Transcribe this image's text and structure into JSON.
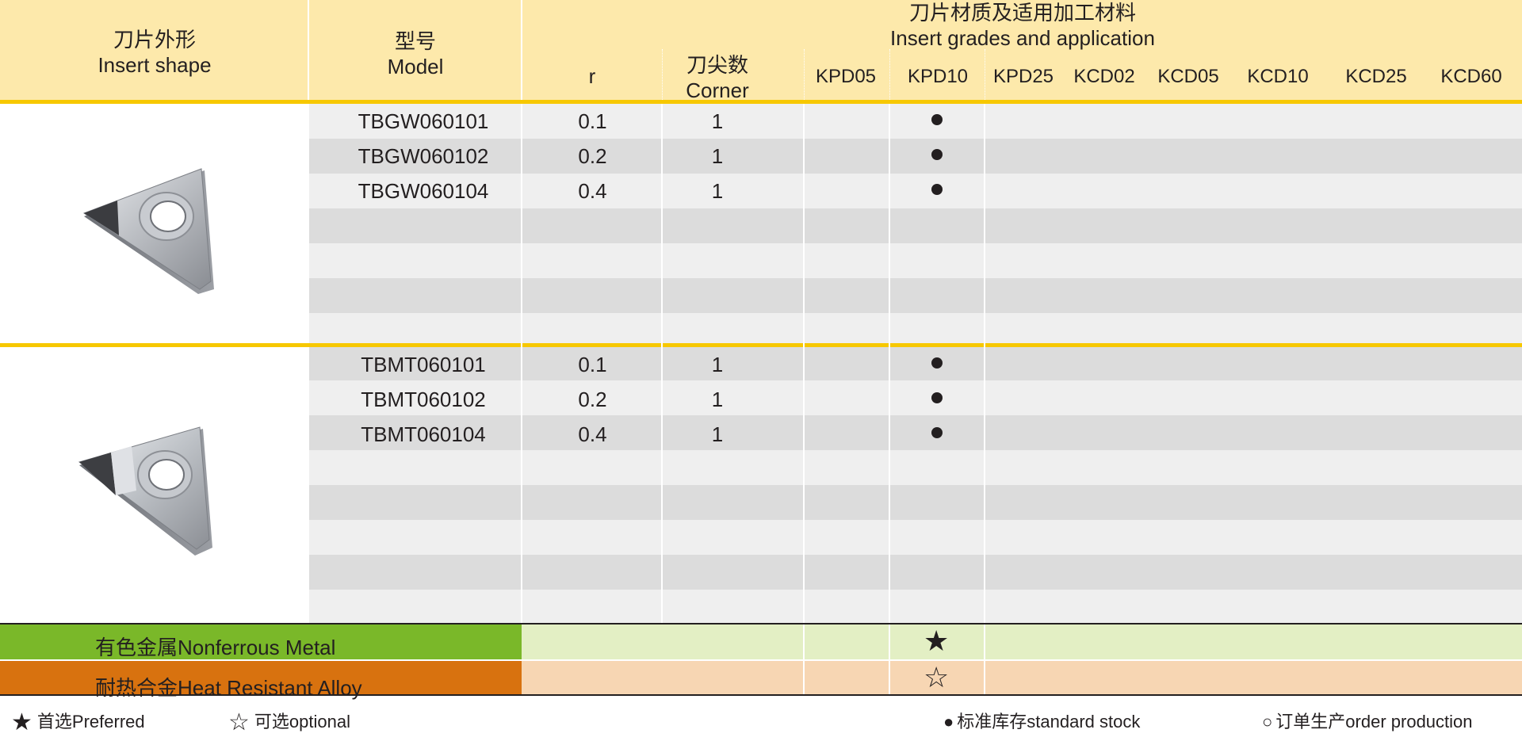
{
  "header": {
    "shape_cn": "刀片外形",
    "shape_en": "Insert shape",
    "model_cn": "型号",
    "model_en": "Model",
    "grades_cn": "刀片材质及适用加工材料",
    "grades_en": "Insert grades and application",
    "r_label": "r",
    "corner_cn": "刀尖数",
    "corner_en": "Corner",
    "grades": [
      "KPD05",
      "KPD10",
      "KPD25",
      "KCD02",
      "KCD05",
      "KCD10",
      "KCD25",
      "KCD60"
    ]
  },
  "groups": [
    {
      "insert_icon": "triangular-insert-tbgw",
      "rows": [
        {
          "model": "TBGW060101",
          "r": "0.1",
          "corner": "1",
          "stock_grade": "KPD10"
        },
        {
          "model": "TBGW060102",
          "r": "0.2",
          "corner": "1",
          "stock_grade": "KPD10"
        },
        {
          "model": "TBGW060104",
          "r": "0.4",
          "corner": "1",
          "stock_grade": "KPD10"
        }
      ]
    },
    {
      "insert_icon": "triangular-insert-tbmt",
      "rows": [
        {
          "model": "TBMT060101",
          "r": "0.1",
          "corner": "1",
          "stock_grade": "KPD10"
        },
        {
          "model": "TBMT060102",
          "r": "0.2",
          "corner": "1",
          "stock_grade": "KPD10"
        },
        {
          "model": "TBMT060104",
          "r": "0.4",
          "corner": "1",
          "stock_grade": "KPD10"
        }
      ]
    }
  ],
  "applications": [
    {
      "label": "有色金属Nonferrous Metal",
      "color": "#7ab829",
      "tint": "#e3efc4",
      "symbol": "★",
      "grade": "KPD10"
    },
    {
      "label": "耐热合金Heat Resistant Alloy",
      "color": "#d8720f",
      "tint": "#f7d6b3",
      "symbol": "☆",
      "grade": "KPD10"
    }
  ],
  "legend": {
    "preferred_symbol": "★",
    "preferred": "首选Preferred",
    "optional_symbol": "☆",
    "optional": "可选optional",
    "stock_symbol": "●",
    "stock": "标准库存standard stock",
    "order_symbol": "○",
    "order": "订单生产order production"
  },
  "colors": {
    "header_bg": "#fde9ab",
    "accent_line": "#f7c800",
    "stripe_light": "#efefef",
    "stripe_dark": "#dcdcdc"
  }
}
